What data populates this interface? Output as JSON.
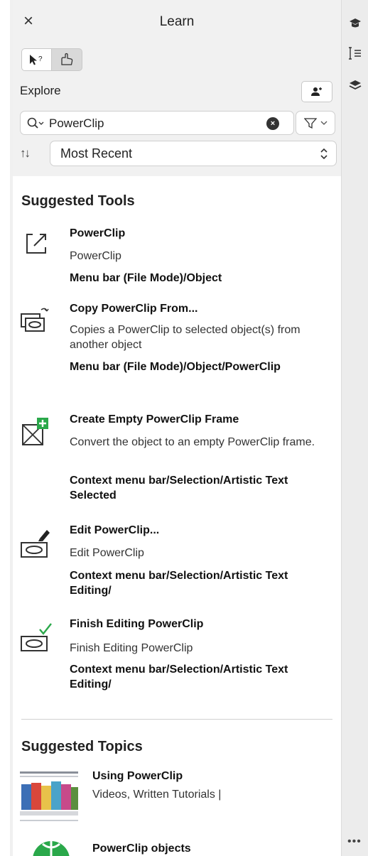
{
  "panel": {
    "title": "Learn",
    "close_label": "×"
  },
  "explore": {
    "label": "Explore",
    "mode_active_icon": "pointer-help-icon",
    "mode_inactive_icon": "hand-help-icon"
  },
  "search": {
    "value": "PowerClip",
    "clear_icon": "×"
  },
  "sort": {
    "icon": "↑↓",
    "value": "Most Recent"
  },
  "tools": {
    "heading": "Suggested Tools",
    "items": [
      {
        "name": "PowerClip",
        "desc": "PowerClip",
        "path": "Menu bar (File Mode)/Object",
        "icon": "powerclip-icon"
      },
      {
        "name": "Copy PowerClip From...",
        "desc": "Copies a PowerClip to selected object(s) from another object",
        "path": "Menu bar (File Mode)/Object/PowerClip",
        "icon": "copy-powerclip-icon"
      },
      {
        "name": "Create Empty PowerClip Frame",
        "desc": "Convert the object to an empty PowerClip frame.",
        "path": "Context menu bar/Selection/Artistic Text Selected",
        "icon": "empty-frame-icon"
      },
      {
        "name": "Edit PowerClip...",
        "desc": "Edit PowerClip",
        "path": "Context menu bar/Selection/Artistic Text Editing/",
        "icon": "edit-powerclip-icon"
      },
      {
        "name": "Finish Editing PowerClip",
        "desc": "Finish Editing PowerClip",
        "path": "Context menu bar/Selection/Artistic Text Editing/",
        "icon": "finish-editing-icon"
      }
    ]
  },
  "topics": {
    "heading": "Suggested Topics",
    "items": [
      {
        "title": "Using PowerClip",
        "meta": "Videos, Written Tutorials |"
      },
      {
        "title": "PowerClip objects",
        "meta": ""
      }
    ]
  },
  "right_bar": {
    "more_label": "•••"
  },
  "colors": {
    "panel_top_bg": "#f1f1f1",
    "accent_green": "#2aa84a",
    "text": "#1a1a1a"
  }
}
